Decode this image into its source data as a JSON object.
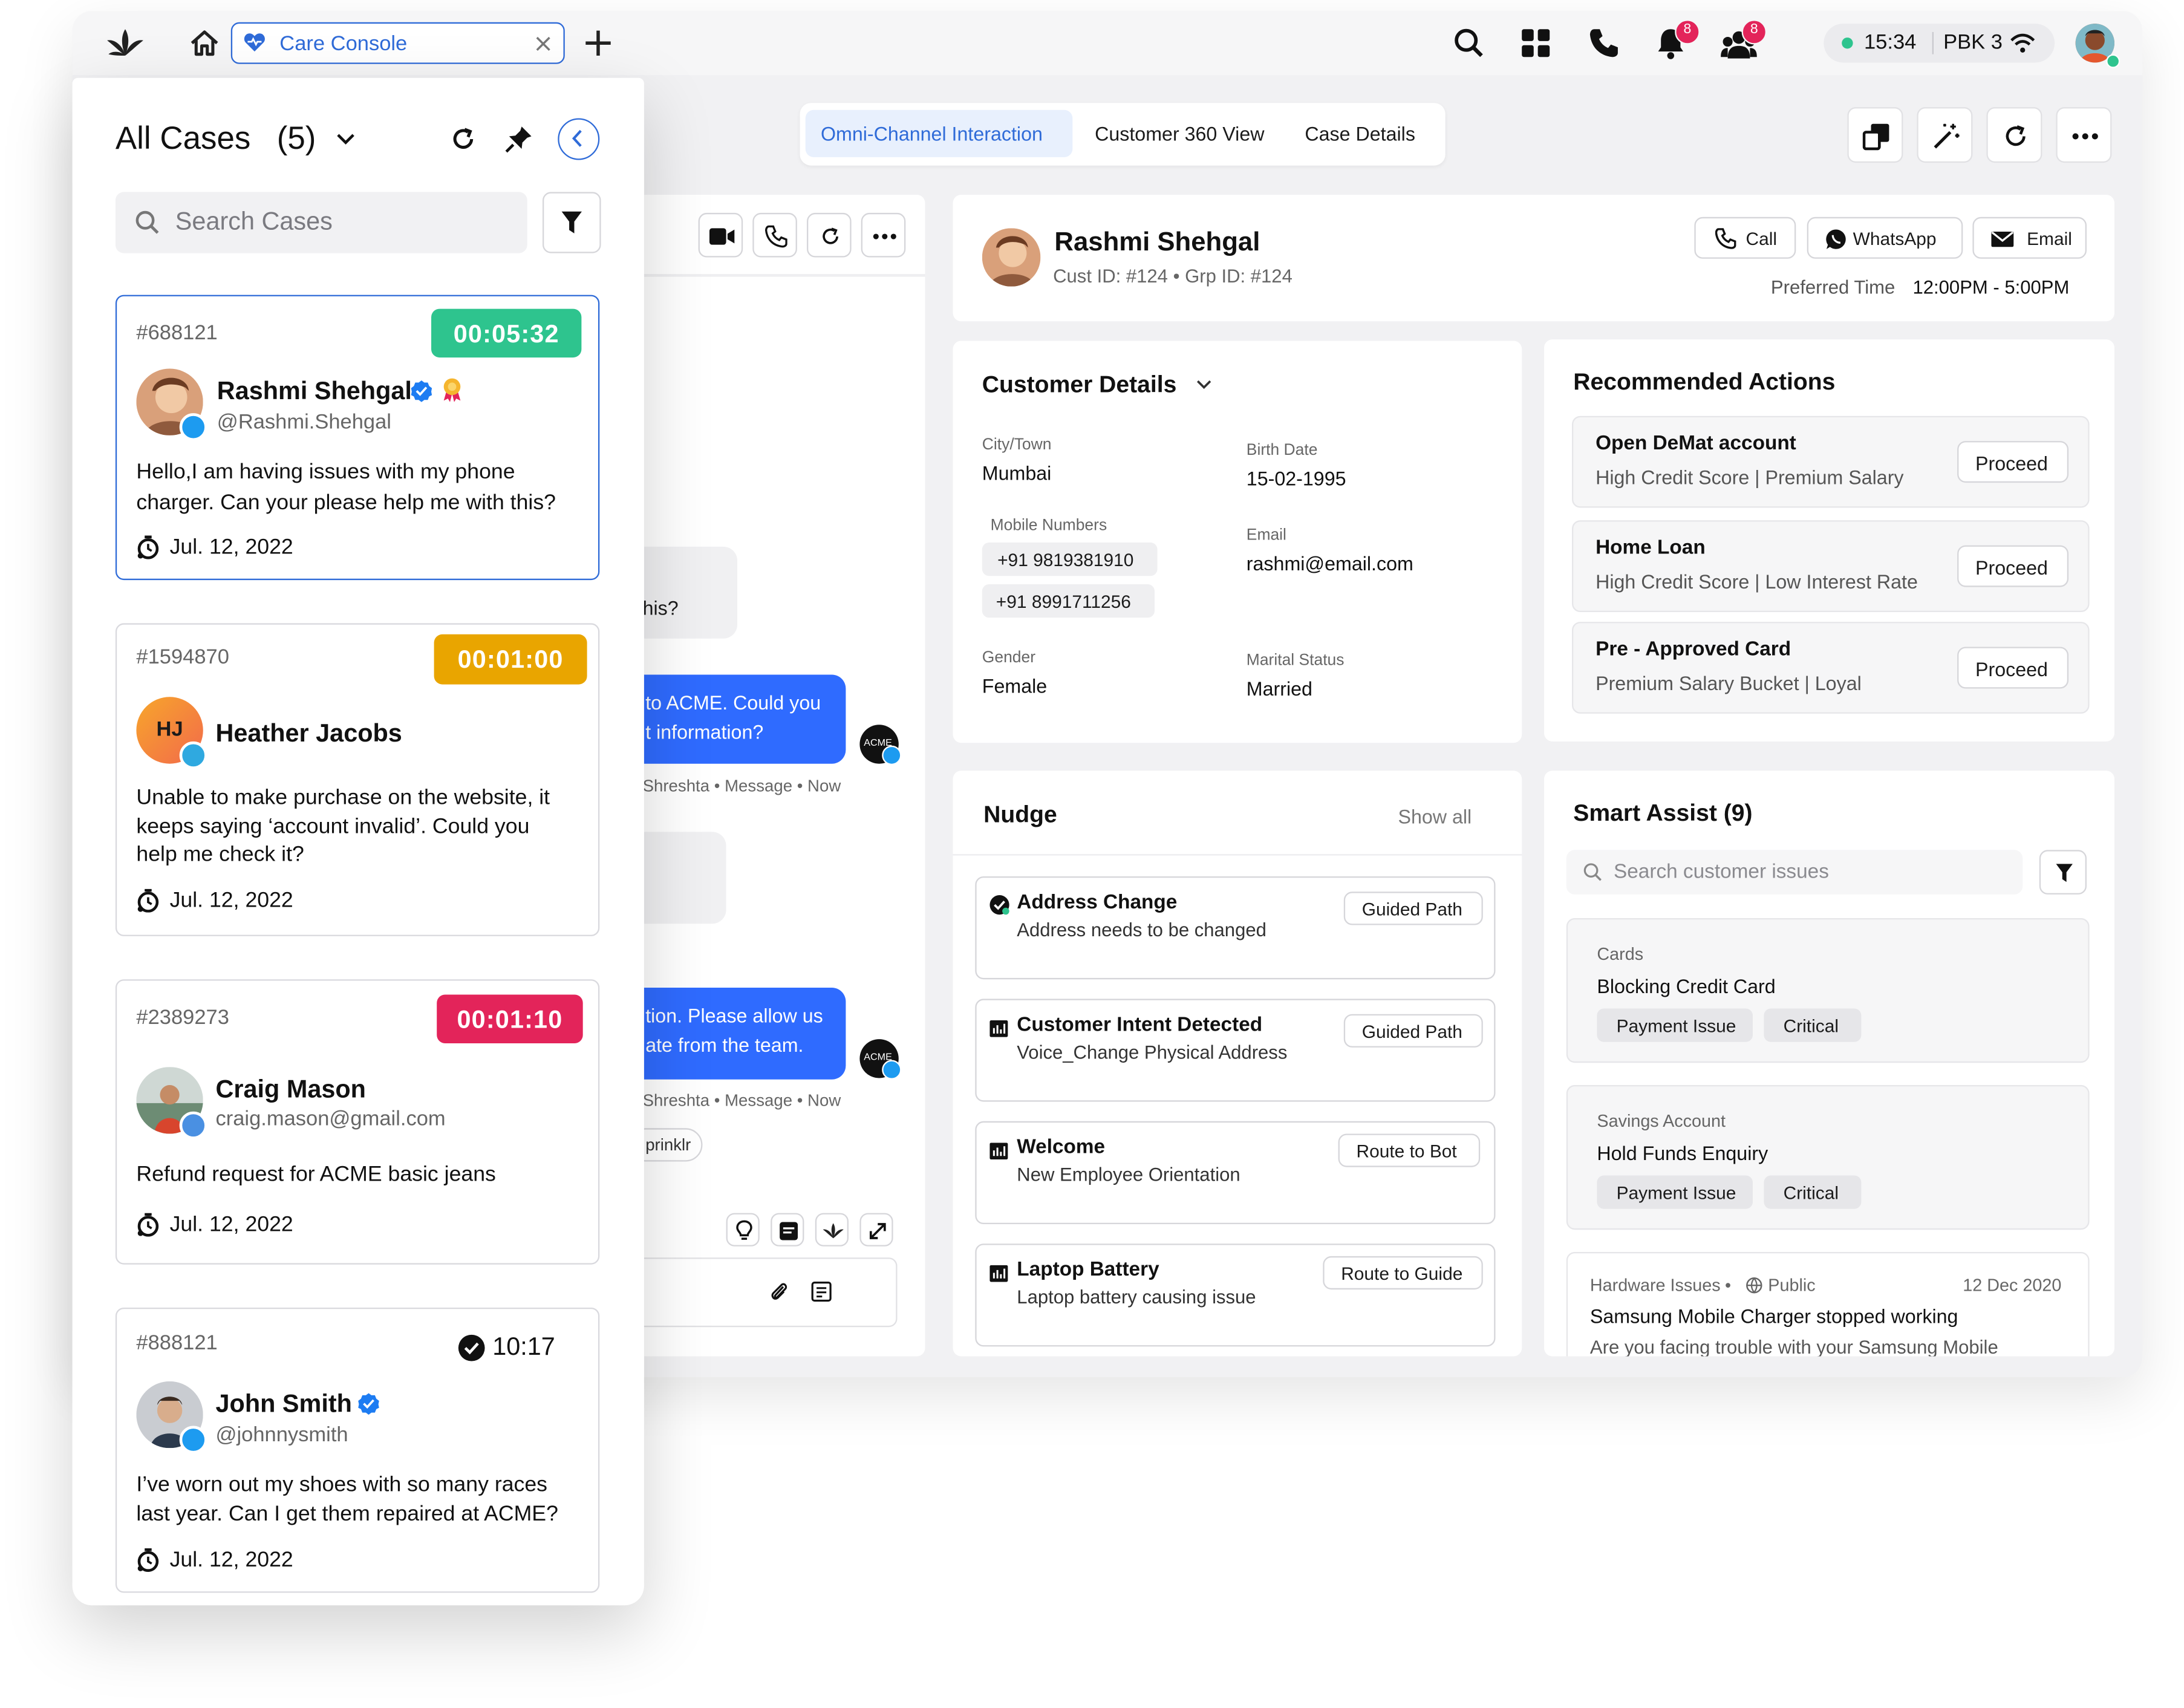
{
  "topbar": {
    "tab_label": "Care Console",
    "time": "15:34",
    "status_label": "PBK 3",
    "notif_count": "8",
    "team_count": "8"
  },
  "view_tabs": [
    "Omni-Channel Interaction",
    "Customer 360 View",
    "Case Details"
  ],
  "cases_panel": {
    "title": "All Cases",
    "count": "(5)",
    "search_placeholder": "Search Cases",
    "cases": [
      {
        "id": "#688121",
        "timer": "00:05:32",
        "timer_color": "#2ec48e",
        "name": "Rashmi Shehgal",
        "handle": "@Rashmi.Shehgal",
        "message": [
          "Hello,I am having issues with my phone",
          "charger. Can your please help me with this?"
        ],
        "date": "Jul. 12, 2022"
      },
      {
        "id": "#1594870",
        "timer": "00:01:00",
        "timer_color": "#e9a500",
        "name": "Heather Jacobs",
        "initials": "HJ",
        "message": [
          "Unable to make purchase on the website, it",
          "keeps saying ‘account invalid’. Could you",
          "help me check it?"
        ],
        "date": "Jul. 12, 2022"
      },
      {
        "id": "#2389273",
        "timer": "00:01:10",
        "timer_color": "#e3245a",
        "name": "Craig Mason",
        "handle": "craig.mason@gmail.com",
        "message": [
          "Refund request for ACME basic jeans"
        ],
        "date": "Jul. 12, 2022"
      },
      {
        "id": "#888121",
        "timer": "10:17",
        "name": "John Smith",
        "handle": "@johnnysmith",
        "message": [
          "I’ve worn out my shoes with so many races",
          "last year. Can I get them repaired at ACME?"
        ],
        "date": "Jul. 12, 2022"
      }
    ]
  },
  "conversation": {
    "bubble1": "his?",
    "bubble2": [
      "to ACME. Could you",
      "t information?"
    ],
    "meta1": "Shreshta • Message • Now",
    "bubble3": [
      "tion. Please allow us",
      "ate from the team."
    ],
    "meta2": "Shreshta • Message • Now",
    "chip": "prinklr",
    "acme": "ACME"
  },
  "profile": {
    "name": "Rashmi Shehgal",
    "ids": "Cust ID: #124 • Grp ID: #124",
    "preferred_label": "Preferred Time",
    "preferred_value": "12:00PM - 5:00PM",
    "btn_call": "Call",
    "btn_whatsapp": "WhatsApp",
    "btn_email": "Email"
  },
  "customer_details": {
    "title": "Customer Details",
    "city_label": "City/Town",
    "city": "Mumbai",
    "birth_label": "Birth Date",
    "birth": "15-02-1995",
    "mobile_label": "Mobile Numbers",
    "mobile1": "+91 9819381910",
    "mobile2": "+91 8991711256",
    "email_label": "Email",
    "email": "rashmi@email.com",
    "gender_label": "Gender",
    "gender": "Female",
    "marital_label": "Marital Status",
    "marital": "Married"
  },
  "recommended": {
    "title": "Recommended Actions",
    "items": [
      {
        "title": "Open DeMat account",
        "sub": "High Credit Score | Premium Salary",
        "action": "Proceed"
      },
      {
        "title": "Home Loan",
        "sub": "High Credit Score | Low Interest Rate",
        "action": "Proceed"
      },
      {
        "title": "Pre - Approved Card",
        "sub": "Premium Salary Bucket | Loyal",
        "action": "Proceed"
      }
    ]
  },
  "nudge": {
    "title": "Nudge",
    "show_all": "Show all",
    "items": [
      {
        "title": "Address Change",
        "sub": "Address needs to be changed",
        "action": "Guided Path"
      },
      {
        "title": "Customer Intent Detected",
        "sub": "Voice_Change Physical Address",
        "action": "Guided Path"
      },
      {
        "title": "Welcome",
        "sub": "New Employee Orientation",
        "action": "Route to Bot"
      },
      {
        "title": "Laptop Battery",
        "sub": "Laptop battery causing issue",
        "action": "Route to Guide"
      }
    ]
  },
  "smart_assist": {
    "title": "Smart Assist (9)",
    "search_placeholder": "Search customer issues",
    "items": [
      {
        "category": "Cards",
        "title": "Blocking Credit Card",
        "tag1": "Payment Issue",
        "tag2": "Critical"
      },
      {
        "category": "Savings Account",
        "title": "Hold Funds Enquiry",
        "tag1": "Payment Issue",
        "tag2": "Critical"
      }
    ],
    "article": {
      "category": "Hardware Issues",
      "visibility": "Public",
      "date": "12 Dec 2020",
      "title": "Samsung Mobile Charger stopped working",
      "snippet": "Are you facing trouble with your Samsung Mobile"
    }
  }
}
